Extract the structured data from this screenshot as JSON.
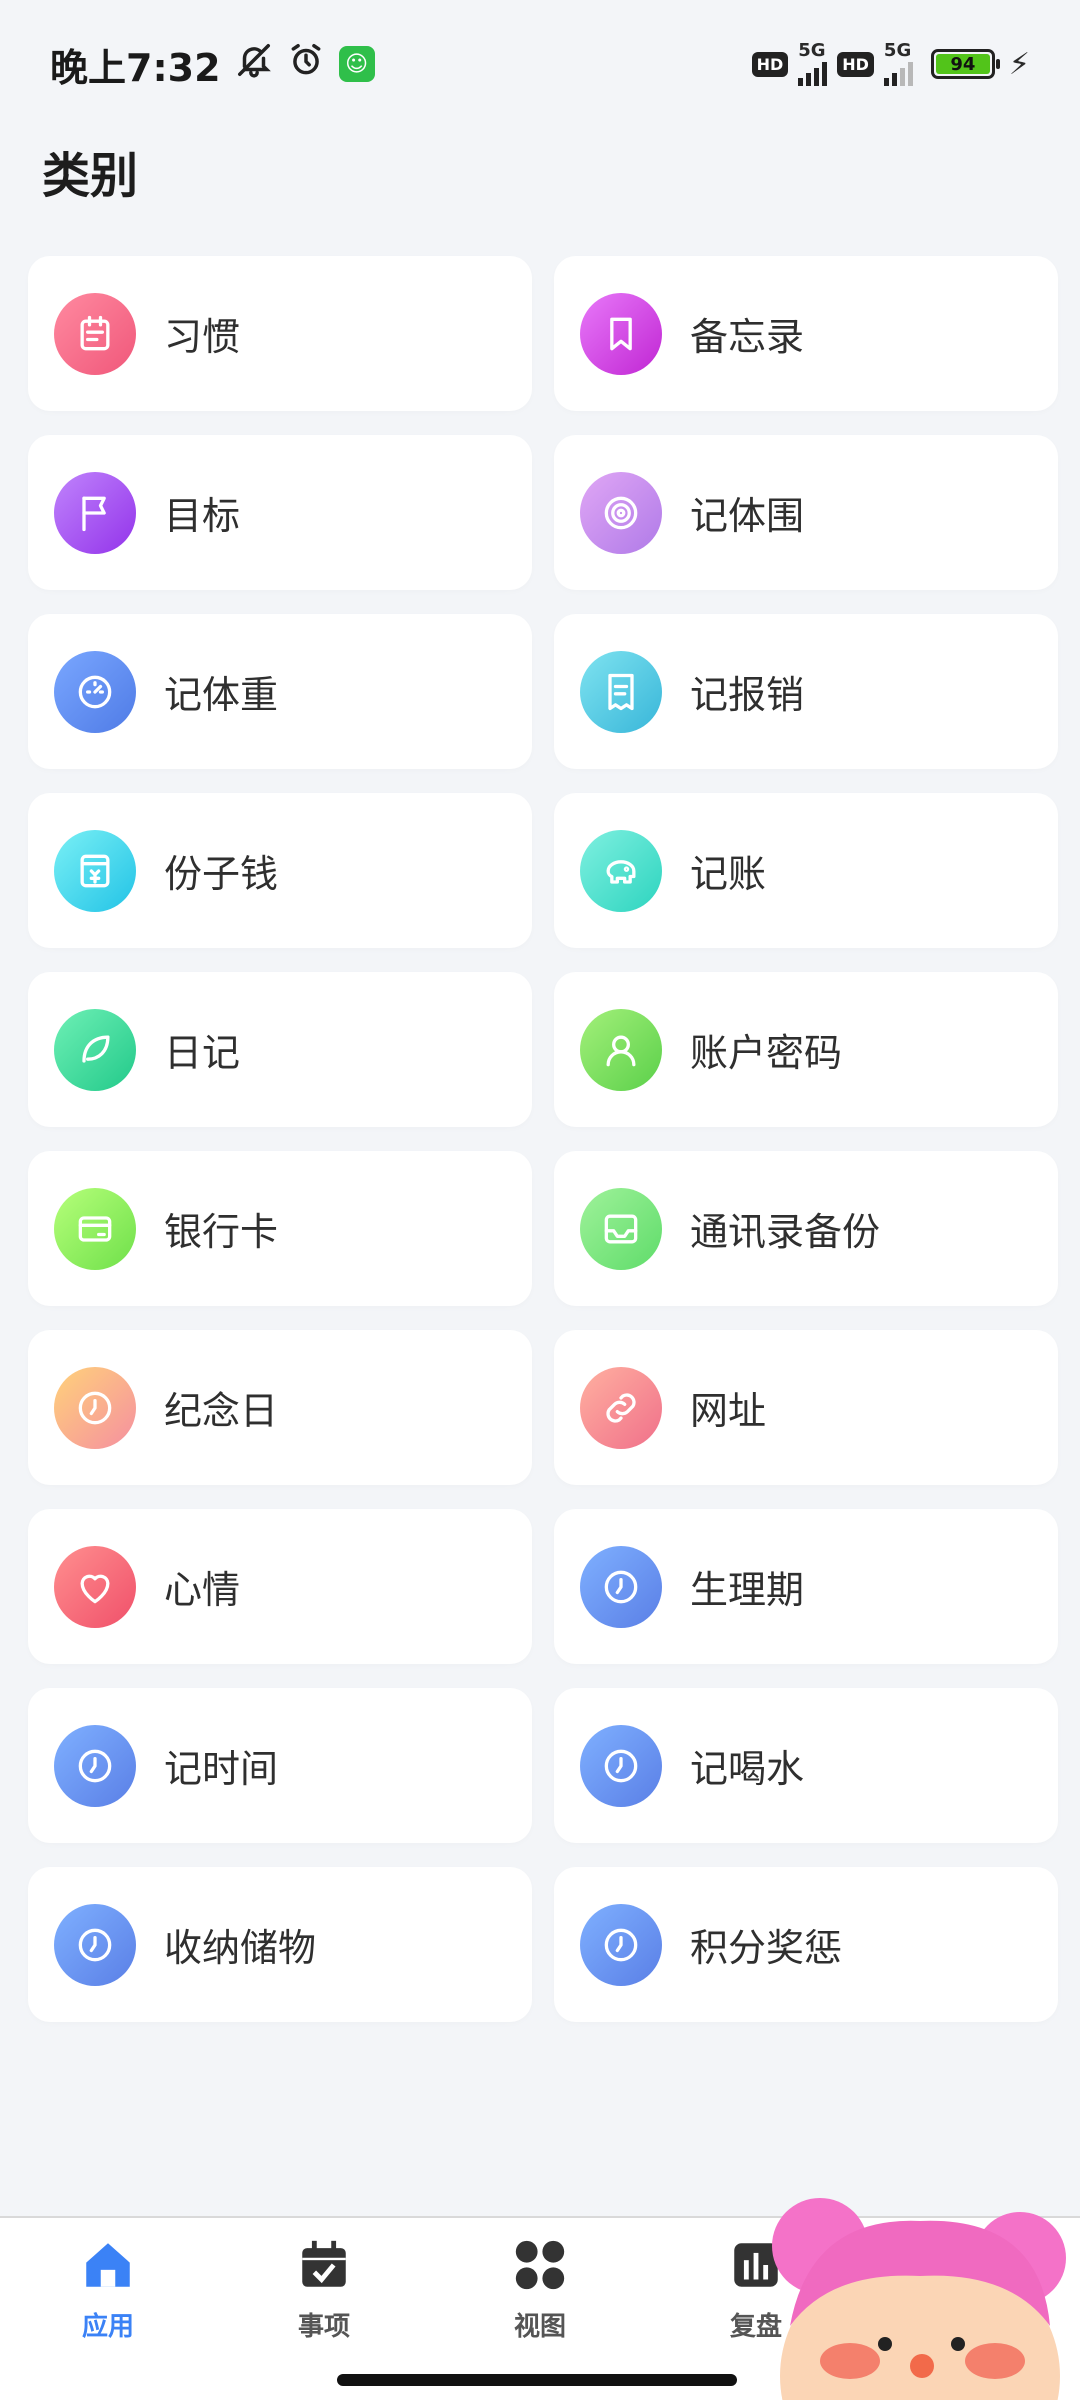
{
  "status_bar": {
    "time": "晚上7:32",
    "battery": "94",
    "hd1": "HD",
    "net1": "5G",
    "hd2": "HD",
    "net2": "5G"
  },
  "page": {
    "title": "类别"
  },
  "categories": [
    {
      "label": "习惯",
      "icon": "calendar-icon",
      "c1": "#ff8aa0",
      "c2": "#f0577a"
    },
    {
      "label": "备忘录",
      "icon": "bookmark-icon",
      "c1": "#e879f9",
      "c2": "#c026d3"
    },
    {
      "label": "目标",
      "icon": "flag-icon",
      "c1": "#c084fc",
      "c2": "#9333ea"
    },
    {
      "label": "记体围",
      "icon": "target-icon",
      "c1": "#e0a7f5",
      "c2": "#b07ae8"
    },
    {
      "label": "记体重",
      "icon": "gauge-icon",
      "c1": "#7aa7ff",
      "c2": "#4f7be6"
    },
    {
      "label": "记报销",
      "icon": "receipt-icon",
      "c1": "#7fe3f0",
      "c2": "#38b6d9"
    },
    {
      "label": "份子钱",
      "icon": "red-packet-icon",
      "c1": "#7af0f5",
      "c2": "#22c3e6"
    },
    {
      "label": "记账",
      "icon": "piggy-bank-icon",
      "c1": "#7ff0e0",
      "c2": "#2dd4bf"
    },
    {
      "label": "日记",
      "icon": "feather-icon",
      "c1": "#6ef0b5",
      "c2": "#22c98a"
    },
    {
      "label": "账户密码",
      "icon": "user-icon",
      "c1": "#a3f07a",
      "c2": "#5bd04a"
    },
    {
      "label": "银行卡",
      "icon": "bank-card-icon",
      "c1": "#b6ff7a",
      "c2": "#6fe04a"
    },
    {
      "label": "通讯录备份",
      "icon": "inbox-icon",
      "c1": "#9ff29a",
      "c2": "#5fdc6a"
    },
    {
      "label": "纪念日",
      "icon": "clock-icon",
      "c1": "#ffd27a",
      "c2": "#f58fa0"
    },
    {
      "label": "网址",
      "icon": "link-icon",
      "c1": "#ffb0a0",
      "c2": "#f0708a"
    },
    {
      "label": "心情",
      "icon": "heart-icon",
      "c1": "#ff8f8f",
      "c2": "#f0506a"
    },
    {
      "label": "生理期",
      "icon": "clock-icon",
      "c1": "#7fb0ff",
      "c2": "#5a7fe6"
    },
    {
      "label": "记时间",
      "icon": "clock-icon",
      "c1": "#7fb0ff",
      "c2": "#5a7fe6"
    },
    {
      "label": "记喝水",
      "icon": "clock-icon",
      "c1": "#7fb0ff",
      "c2": "#5a7fe6"
    },
    {
      "label": "收纳储物",
      "icon": "clock-icon",
      "c1": "#7fb0ff",
      "c2": "#5a7fe6"
    },
    {
      "label": "积分奖惩",
      "icon": "clock-icon",
      "c1": "#7fb0ff",
      "c2": "#5a7fe6"
    }
  ],
  "bottom_nav": [
    {
      "label": "应用",
      "icon": "home-icon",
      "active": true
    },
    {
      "label": "事项",
      "icon": "calendar-check-icon",
      "active": false
    },
    {
      "label": "视图",
      "icon": "clover-icon",
      "active": false
    },
    {
      "label": "复盘",
      "icon": "bar-chart-icon",
      "active": false
    }
  ],
  "colors": {
    "accent": "#3b82f6",
    "background": "#f3f5f8"
  }
}
